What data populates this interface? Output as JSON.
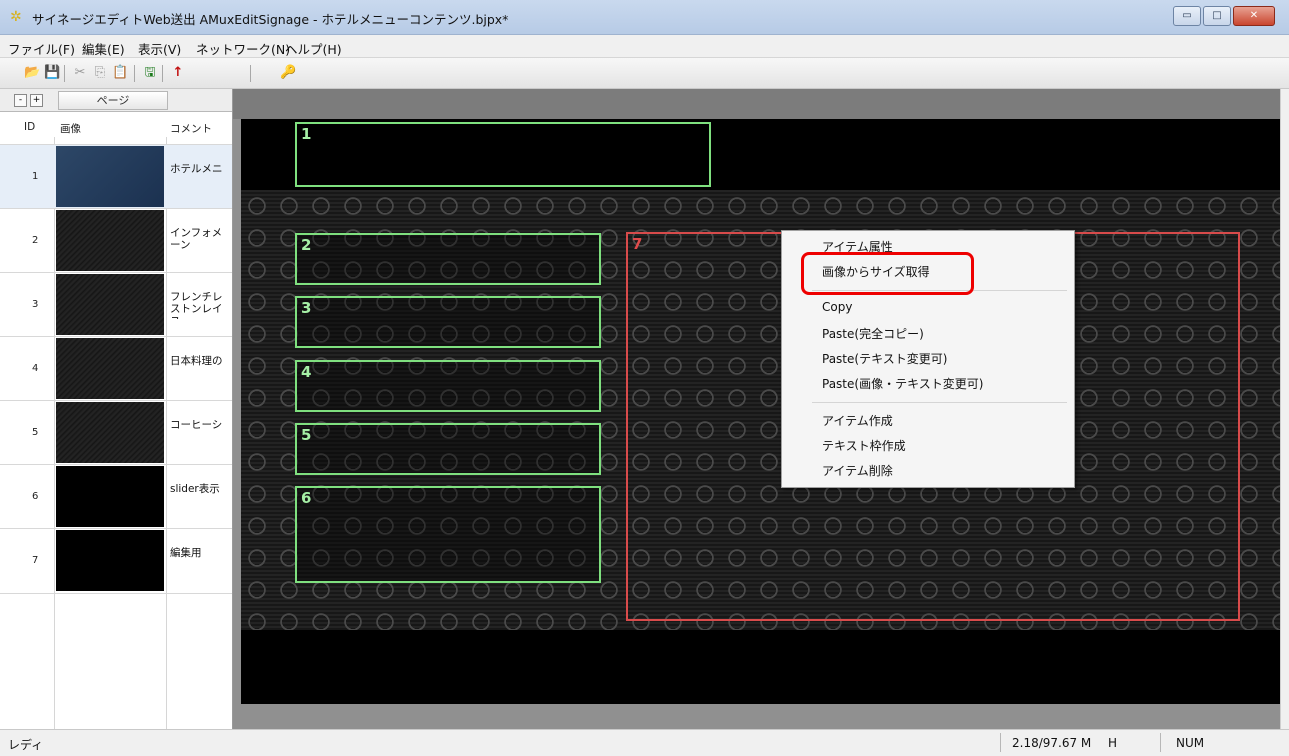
{
  "window": {
    "title": "サイネージエディトWeb送出 AMuxEditSignage - ホテルメニューコンテンツ.bjpx*",
    "minimize": "▭",
    "maximize": "□",
    "close": "✕"
  },
  "menubar": [
    "ファイル(F)",
    "編集(E)",
    "表示(V)",
    "ネットワーク(N)",
    "ヘルプ(H)"
  ],
  "toolbar": {
    "open": "📂",
    "save": "💾",
    "cut": "✂",
    "copy": "⎘",
    "paste": "📋",
    "saveas": "🖫",
    "upload": "↑",
    "key": "🔑"
  },
  "left_panel": {
    "collapse": "-",
    "expand": "+",
    "page_label": "ページ",
    "columns": {
      "id": "ID",
      "image": "画像",
      "comment": "コメント"
    },
    "rows": [
      {
        "id": "1",
        "comment": "ホテルメニ"
      },
      {
        "id": "2",
        "comment": "インフォメーン"
      },
      {
        "id": "3",
        "comment": "フレンチレストンレイユ"
      },
      {
        "id": "4",
        "comment": "日本料理の"
      },
      {
        "id": "5",
        "comment": "コーヒーシ"
      },
      {
        "id": "6",
        "comment": "slider表示"
      },
      {
        "id": "7",
        "comment": "編集用"
      }
    ]
  },
  "canvas": {
    "items": [
      "1",
      "2",
      "3",
      "4",
      "5",
      "6",
      "7"
    ]
  },
  "context_menu": {
    "items": [
      "アイテム属性",
      "画像からサイズ取得",
      "Copy",
      "Paste(完全コピー)",
      "Paste(テキスト変更可)",
      "Paste(画像・テキスト変更可)",
      "アイテム作成",
      "テキスト枠作成",
      "アイテム削除"
    ]
  },
  "statusbar": {
    "status": "レディ",
    "memory": "2.18/97.67 M",
    "h": "H",
    "num": "NUM"
  }
}
